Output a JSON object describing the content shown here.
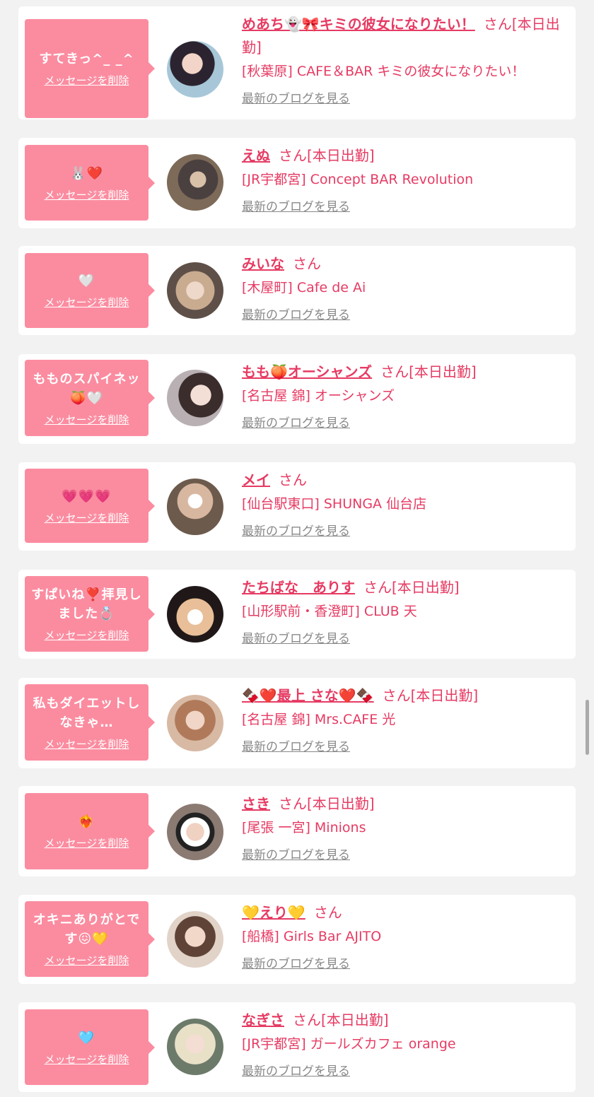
{
  "delete_label": "メッセージを削除",
  "blog_label": "最新のブログを見る",
  "suffix": "さん",
  "colors": {
    "accent": "#e63b63",
    "bubble": "#fb8ca0",
    "background": "#f2f2f2"
  },
  "items": [
    {
      "message": "すてきっ^_ _^",
      "name": "めあち👻🎀キミの彼女になりたい！",
      "status": "[本日出勤]",
      "shop": "[秋葉原] CAFE＆BAR キミの彼女になりたい！"
    },
    {
      "message": "🐰❤️",
      "name": "えぬ",
      "status": "[本日出勤]",
      "shop": "[JR宇都宮] Concept BAR Revolution"
    },
    {
      "message": "🤍",
      "name": "みいな",
      "status": "",
      "shop": "[木屋町] Cafe de Ai"
    },
    {
      "message": "もものスパイネッ🍑🤍",
      "name": "もも🍑オーシャンズ",
      "status": "[本日出勤]",
      "shop": "[名古屋 錦] オーシャンズ"
    },
    {
      "message": "💗💗💗",
      "name": "メイ",
      "status": "",
      "shop": "[仙台駅東口] SHUNGA 仙台店"
    },
    {
      "message": "すぱいね❣️拝見しました💍",
      "name": "たちばな　ありす",
      "status": "[本日出勤]",
      "shop": "[山形駅前・香澄町] CLUB 天"
    },
    {
      "message": "私もダイエットしなきゃ…",
      "name": "🍫❤️最上 さな❤️🍫",
      "status": "[本日出勤]",
      "shop": "[名古屋 錦] Mrs.CAFE 光"
    },
    {
      "message": "❤️‍🔥",
      "name": "さき",
      "status": "[本日出勤]",
      "shop": "[尾張 一宮] Minions"
    },
    {
      "message": "オキニありがとです😖💛",
      "name": "💛えり💛",
      "status": "",
      "shop": "[船橋] Girls Bar AJITO"
    },
    {
      "message": "🩵",
      "name": "なぎさ",
      "status": "[本日出勤]",
      "shop": "[JR宇都宮] ガールズカフェ orange"
    }
  ]
}
